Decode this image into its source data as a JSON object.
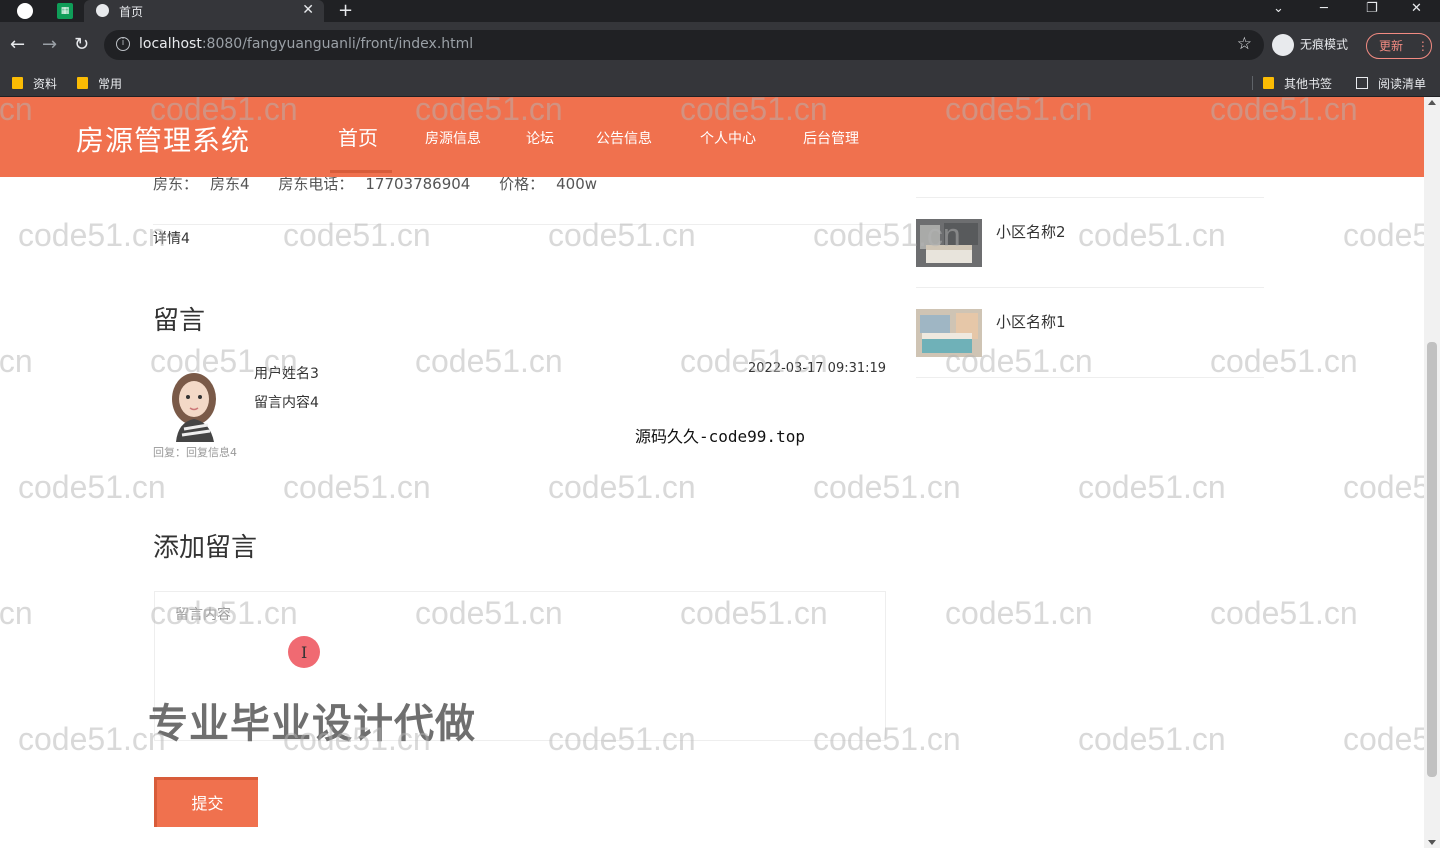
{
  "browser": {
    "tab_title": "首页",
    "url_host": "localhost",
    "url_rest": ":8080/fangyuanguanli/front/index.html",
    "incognito_label": "无痕模式",
    "update_label": "更新",
    "bookmarks": [
      "资料",
      "常用"
    ],
    "bookmarks_right": [
      "其他书签",
      "阅读清单"
    ]
  },
  "site": {
    "logo": "房源管理系统",
    "nav": [
      "首页",
      "房源信息",
      "论坛",
      "公告信息",
      "个人中心",
      "后台管理"
    ],
    "accent_color": "#f0714e"
  },
  "house": {
    "landlord_label": "房东：",
    "landlord": "房东4",
    "phone_label": "房东电话：",
    "phone": "17703786904",
    "price_label": "价格：",
    "price": "400w",
    "detail": "详情4"
  },
  "comments": {
    "title": "留言",
    "items": [
      {
        "user": "用户姓名3",
        "content": "留言内容4",
        "time": "2022-03-17 09:31:19",
        "reply": "回复：回复信息4"
      }
    ]
  },
  "center_note": "源码久久-code99.top",
  "add_comment": {
    "title": "添加留言",
    "placeholder": "留言内容",
    "submit": "提交"
  },
  "sidebar": {
    "items": [
      {
        "name": "小区名称2"
      },
      {
        "name": "小区名称1"
      }
    ]
  },
  "overlay": "专业毕业设计代做",
  "watermark": "code51.cn"
}
